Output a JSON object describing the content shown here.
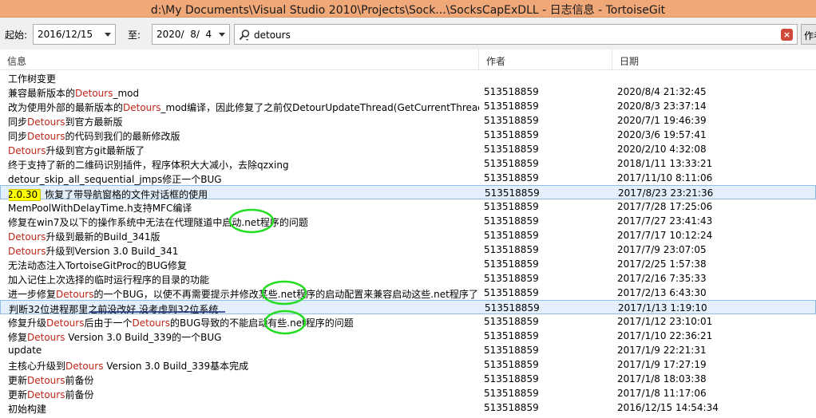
{
  "window": {
    "title": "d:\\My Documents\\Visual Studio 2010\\Projects\\Sock...\\SocksCapExDLL - 日志信息 - TortoiseGit"
  },
  "filter": {
    "from_label": "起始:",
    "from_date": "2016/12/15",
    "to_label": "至:",
    "to_date": "2020/  8/  4",
    "search_value": "detours",
    "author_button": "作者"
  },
  "columns": {
    "message": "信息",
    "author": "作者",
    "date": "日期"
  },
  "rows": [
    {
      "segments": [
        {
          "t": "工作树变更"
        }
      ],
      "author": "",
      "date": ""
    },
    {
      "segments": [
        {
          "t": "兼容最新版本的"
        },
        {
          "t": "Detours",
          "h": true
        },
        {
          "t": "_mod"
        }
      ],
      "author": "513518859",
      "date": "2020/8/4 21:32:45"
    },
    {
      "segments": [
        {
          "t": "改为使用外部的最新版本的"
        },
        {
          "t": "Detours",
          "h": true
        },
        {
          "t": "_mod编译，因此修复了之前仅DetourUpdateThread(GetCurrentThread…"
        }
      ],
      "author": "513518859",
      "date": "2020/8/3 23:37:14"
    },
    {
      "segments": [
        {
          "t": "同步"
        },
        {
          "t": "Detours",
          "h": true
        },
        {
          "t": "到官方最新版"
        }
      ],
      "author": "513518859",
      "date": "2020/7/1 19:46:39"
    },
    {
      "segments": [
        {
          "t": "同步"
        },
        {
          "t": "Detours",
          "h": true
        },
        {
          "t": "的代码到我们的最新修改版"
        }
      ],
      "author": "513518859",
      "date": "2020/3/6 19:57:41"
    },
    {
      "segments": [
        {
          "t": "Detours",
          "h": true
        },
        {
          "t": "升级到官方git最新版了"
        }
      ],
      "author": "513518859",
      "date": "2020/2/10 4:32:08"
    },
    {
      "segments": [
        {
          "t": "终于支持了新的二维码识别插件，程序体积大大减小，去除qzxing"
        }
      ],
      "author": "513518859",
      "date": "2018/1/11 13:33:21"
    },
    {
      "segments": [
        {
          "t": "detour_skip_all_sequential_jmps修正一个BUG"
        }
      ],
      "author": "513518859",
      "date": "2017/11/10 8:11:06"
    },
    {
      "tag": "2.0.30",
      "segments": [
        {
          "t": "恢复了带导航窗格的文件对话框的使用"
        }
      ],
      "author": "513518859",
      "date": "2017/8/23 23:21:36",
      "selected": true,
      "underline": true
    },
    {
      "segments": [
        {
          "t": "MemPoolWithDelayTime.h支持MFC编译"
        }
      ],
      "author": "513518859",
      "date": "2017/7/28 17:25:06"
    },
    {
      "segments": [
        {
          "t": "修复在win7及以下的操作系统中无法在代理隧道中启动.net程序的问题"
        }
      ],
      "author": "513518859",
      "date": "2017/7/27 23:41:43"
    },
    {
      "segments": [
        {
          "t": "Detours",
          "h": true
        },
        {
          "t": "升级到最新的Build_341版"
        }
      ],
      "author": "513518859",
      "date": "2017/7/17 10:12:24"
    },
    {
      "segments": [
        {
          "t": "Detours",
          "h": true
        },
        {
          "t": "升级到Version 3.0 Build_341"
        }
      ],
      "author": "513518859",
      "date": "2017/7/9 23:07:05"
    },
    {
      "segments": [
        {
          "t": "无法动态注入TortoiseGitProc的BUG修复"
        }
      ],
      "author": "513518859",
      "date": "2017/2/25 1:57:38"
    },
    {
      "segments": [
        {
          "t": "加入记住上次选择的临时运行程序的目录的功能"
        }
      ],
      "author": "513518859",
      "date": "2017/2/16 7:35:33"
    },
    {
      "segments": [
        {
          "t": "进一步修复"
        },
        {
          "t": "Detours",
          "h": true
        },
        {
          "t": "的一个BUG，以使不再需要提示并修改某些.net程序的启动配置来兼容启动这些.net程序了"
        }
      ],
      "author": "513518859",
      "date": "2017/2/13 6:43:30"
    },
    {
      "segments": [
        {
          "t": "判断32位进程那里之前没改好 没考虑到32位系统"
        }
      ],
      "author": "513518859",
      "date": "2017/1/13 1:19:10",
      "selected": true,
      "underline": true
    },
    {
      "segments": [
        {
          "t": "修复升级"
        },
        {
          "t": "Detours",
          "h": true
        },
        {
          "t": "后由于一个"
        },
        {
          "t": "Detours",
          "h": true
        },
        {
          "t": "的BUG导致的不能启动有些.net程序的问题"
        }
      ],
      "author": "513518859",
      "date": "2017/1/12 23:10:01"
    },
    {
      "segments": [
        {
          "t": "修复"
        },
        {
          "t": "Detours",
          "h": true
        },
        {
          "t": " Version 3.0 Build_339的一个BUG"
        }
      ],
      "author": "513518859",
      "date": "2017/1/10 22:36:21"
    },
    {
      "segments": [
        {
          "t": "update"
        }
      ],
      "author": "513518859",
      "date": "2017/1/9 22:21:31"
    },
    {
      "segments": [
        {
          "t": "主核心升级到"
        },
        {
          "t": "Detours",
          "h": true
        },
        {
          "t": " Version 3.0 Build_339基本完成"
        }
      ],
      "author": "513518859",
      "date": "2017/1/9 17:27:19"
    },
    {
      "segments": [
        {
          "t": "更新"
        },
        {
          "t": "Detours",
          "h": true
        },
        {
          "t": "前备份"
        }
      ],
      "author": "513518859",
      "date": "2017/1/8 18:03:38"
    },
    {
      "segments": [
        {
          "t": "更新"
        },
        {
          "t": "Detours",
          "h": true
        },
        {
          "t": "前备份"
        }
      ],
      "author": "513518859",
      "date": "2017/1/8 11:17:06"
    },
    {
      "segments": [
        {
          "t": "初始构建"
        }
      ],
      "author": "513518859",
      "date": "2016/12/15 14:54:34"
    }
  ],
  "colors": {
    "title_bg": "#f0a878",
    "highlight_text": "#c0261a",
    "selected_row": "#e3effa",
    "tag_bg": "#ffff00",
    "annotation_circle": "#22dd22"
  }
}
